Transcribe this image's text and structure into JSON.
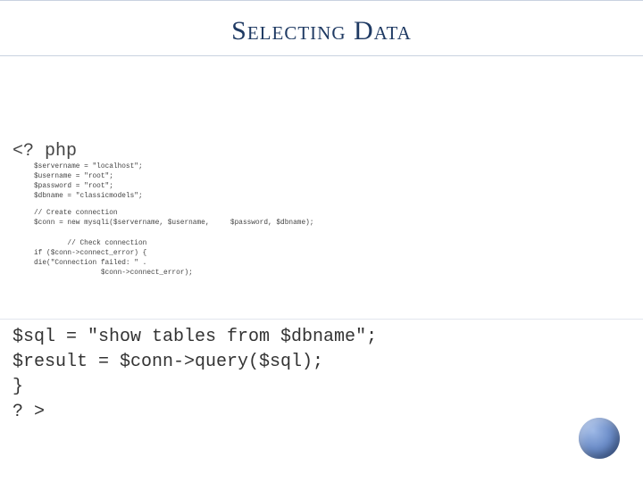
{
  "title": "Selecting Data",
  "php_open": "<? php",
  "code_block_1": "$servername = \"localhost\";\n$username = \"root\";\n$password = \"root\";\n$dbname = \"classicmodels\";",
  "code_block_2": "// Create connection\n$conn = new mysqli($servername, $username,     $password, $dbname);",
  "code_block_3_line1_indent": "        // Check connection",
  "code_block_3_line2": "if ($conn->connect_error) {",
  "code_block_3_line3": "die(\"Connection failed: \" .",
  "code_block_3_line4_indent": "                $conn->connect_error);",
  "code_big": "$sql = \"show tables from $dbname\";\n$result = $conn->query($sql);\n}\n? >"
}
